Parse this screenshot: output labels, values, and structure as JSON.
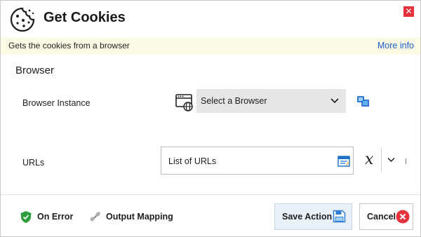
{
  "dialog": {
    "title": "Get Cookies",
    "close_label": "✕",
    "description": "Gets the cookies from a browser",
    "more_info": "More info"
  },
  "section": {
    "title": "Browser"
  },
  "fields": {
    "browser_instance": {
      "label": "Browser Instance",
      "value": "Select a Browser"
    },
    "urls": {
      "label": "URLs",
      "value": "List of URLs",
      "variable_glyph": "x"
    }
  },
  "footer": {
    "on_error": "On Error",
    "output_mapping": "Output Mapping",
    "save": "Save Action",
    "cancel": "Cancel"
  },
  "colors": {
    "close_red": "#e6323c",
    "link_blue": "#1a5ccc",
    "info_bg": "#fbfbe6",
    "shield_green": "#2e9e3f",
    "save_bg": "#e8f0fa",
    "cancel_red": "#e6323c"
  },
  "icons": [
    "cookie-icon",
    "close-icon",
    "browser-icon",
    "chevron-down-icon",
    "pick-browser-icon",
    "list-icon",
    "variable-icon",
    "shield-icon",
    "output-mapping-icon",
    "save-icon",
    "cancel-icon"
  ]
}
